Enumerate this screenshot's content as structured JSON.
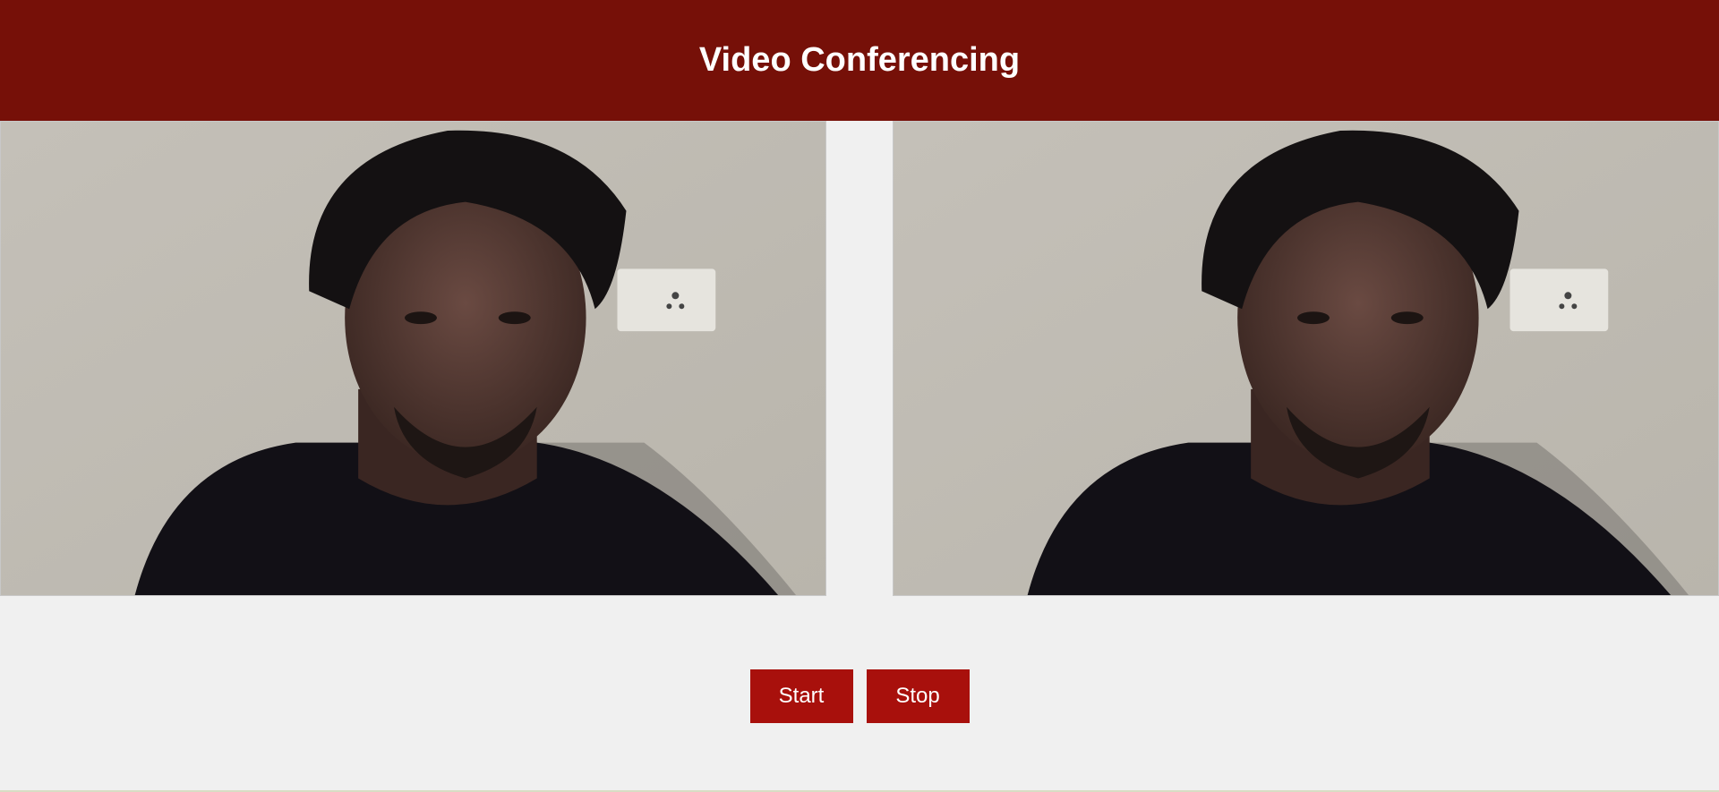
{
  "header": {
    "title": "Video Conferencing",
    "background_color": "#761008"
  },
  "videos": [
    {
      "role": "local",
      "content": "webcam feed"
    },
    {
      "role": "remote",
      "content": "webcam feed"
    }
  ],
  "controls": {
    "start_label": "Start",
    "stop_label": "Stop",
    "button_color": "#a8100c"
  }
}
